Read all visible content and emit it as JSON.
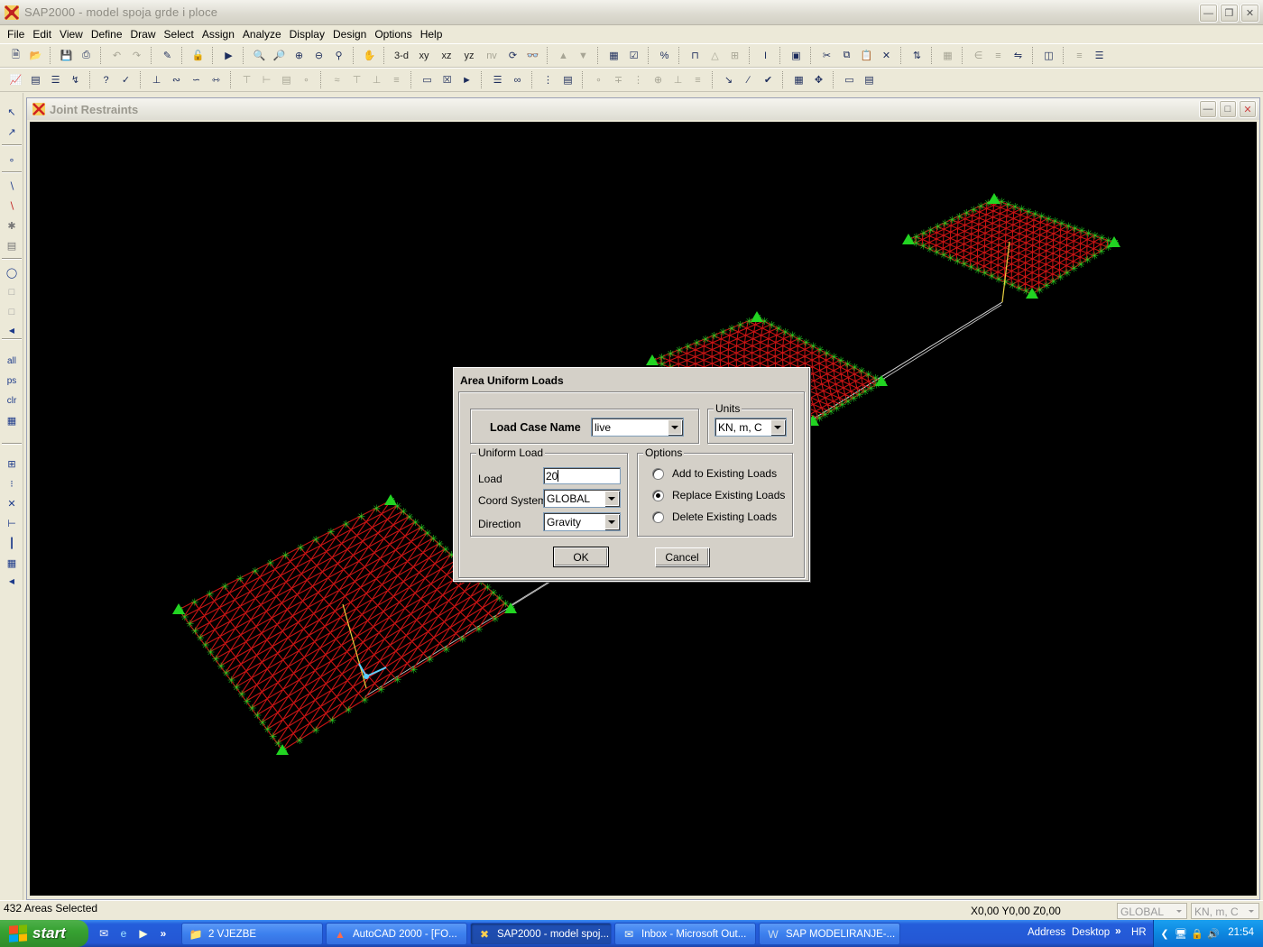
{
  "window": {
    "title": "SAP2000 - model spoja grde i ploce",
    "minimize_icon": "minimize-icon",
    "restore_icon": "restore-icon",
    "close_icon": "close-icon"
  },
  "menu": {
    "items": [
      "File",
      "Edit",
      "View",
      "Define",
      "Draw",
      "Select",
      "Assign",
      "Analyze",
      "Display",
      "Design",
      "Options",
      "Help"
    ]
  },
  "toolbar": {
    "view_3d": "3-d",
    "view_xy": "xy",
    "view_xz": "xz",
    "view_yz": "yz",
    "view_nv": "nv"
  },
  "left_toolbar": {
    "all": "all",
    "ps": "ps",
    "clr": "clr"
  },
  "child_window": {
    "title": "Joint Restraints"
  },
  "dialog": {
    "title": "Area Uniform Loads",
    "load_case_label": "Load Case Name",
    "load_case_value": "live",
    "units_legend": "Units",
    "units_value": "KN, m, C",
    "uniform_load_legend": "Uniform Load",
    "load_label": "Load",
    "load_value": "20",
    "coord_system_label": "Coord System",
    "coord_system_value": "GLOBAL",
    "direction_label": "Direction",
    "direction_value": "Gravity",
    "options_legend": "Options",
    "options": [
      {
        "label": "Add to Existing Loads",
        "checked": false
      },
      {
        "label": "Replace Existing Loads",
        "checked": true
      },
      {
        "label": "Delete Existing Loads",
        "checked": false
      }
    ],
    "ok_label": "OK",
    "cancel_label": "Cancel"
  },
  "status": {
    "selection": "432 Areas Selected",
    "coordinates": "X0,00  Y0,00  Z0,00",
    "coord_system": "GLOBAL",
    "units": "KN, m, C"
  },
  "taskbar": {
    "start_label": "start",
    "tasks": [
      {
        "label": "2 VJEZBE",
        "icon": "folder-icon",
        "active": false
      },
      {
        "label": "AutoCAD 2000 - [FO...",
        "icon": "autocad-icon",
        "active": false
      },
      {
        "label": "SAP2000 - model spoj...",
        "icon": "sap2000-icon",
        "active": true
      },
      {
        "label": "Inbox - Microsoft Out...",
        "icon": "outlook-icon",
        "active": false
      },
      {
        "label": "SAP  MODELIRANJE-...",
        "icon": "word-icon",
        "active": false
      }
    ],
    "address_label": "Address",
    "desktop_label": "Desktop",
    "language": "HR",
    "clock": "21:54"
  },
  "colors": {
    "mesh": "#c81414",
    "restraint": "#22d422",
    "frame": "#d0d0d0",
    "axis": "#e8d040",
    "canvas_bg": "#000000"
  }
}
